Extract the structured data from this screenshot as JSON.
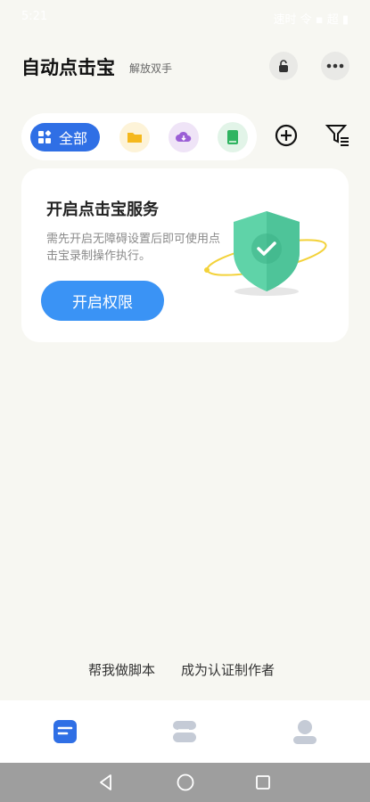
{
  "status_bar": {
    "time": "5:21",
    "right_text": "速时 令 ▪ 超 ▮"
  },
  "header": {
    "title": "自动点击宝",
    "subtitle": "解放双手",
    "lock_icon": "lock-icon",
    "more_icon": "more-icon"
  },
  "tabs": {
    "all_label": "全部",
    "items": [
      "folder-icon",
      "cloud-download-icon",
      "book-icon"
    ]
  },
  "service_card": {
    "title": "开启点击宝服务",
    "description": "需先开启无障碍设置后即可使用点击宝录制操作执行。",
    "button_label": "开启权限"
  },
  "footer": {
    "help_link": "帮我做脚本",
    "creator_link": "成为认证制作者"
  },
  "bottom_nav": {
    "items": [
      "home-doc-icon",
      "library-icon",
      "profile-icon"
    ],
    "active": "home-doc-icon"
  },
  "colors": {
    "accent": "#2f6fe5",
    "button": "#3a93f5",
    "shield": "#5fd3a8",
    "background": "#f7f7f2"
  }
}
